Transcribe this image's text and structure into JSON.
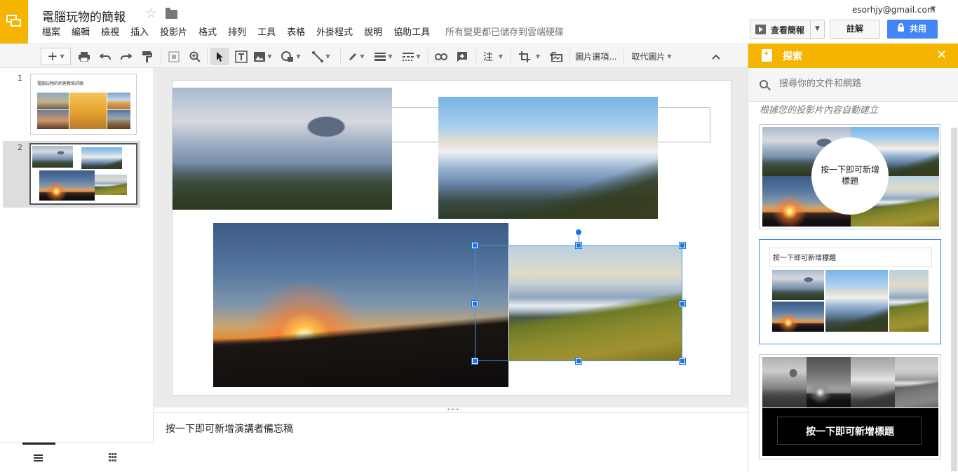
{
  "header": {
    "doc_title": "電腦玩物的簡報",
    "save_status": "所有變更都已儲存到雲端硬碟",
    "account_email": "esorhjy@gmail.com",
    "present_label": "查看簡報",
    "comments_label": "註解",
    "share_label": "共用"
  },
  "menu": [
    "檔案",
    "編輯",
    "檢視",
    "插入",
    "投影片",
    "格式",
    "排列",
    "工具",
    "表格",
    "外掛程式",
    "說明",
    "協助工具"
  ],
  "toolbar": {
    "new_slide_label": "+",
    "number_label": "注",
    "image_options_label": "圖片選項...",
    "replace_image_label": "取代圖片"
  },
  "filmstrip": {
    "slides": [
      {
        "number": "1",
        "title": "電腦玩物的刺客教條評論"
      },
      {
        "number": "2"
      }
    ]
  },
  "notes": {
    "placeholder": "按一下即可新增演講者備忘稿"
  },
  "explore": {
    "title": "探索",
    "search_placeholder": "搜尋你的文件和網路",
    "section_label": "根據您的投影片內容自動建立",
    "cards": [
      {
        "label": "按一下即可新增標題"
      },
      {
        "label": "按一下即可新增標題"
      },
      {
        "label": "按一下即可新增標題"
      }
    ]
  },
  "colors": {
    "brand_yellow": "#f4b400",
    "share_blue": "#4285f4",
    "selection_blue": "#1a73e8"
  },
  "icons": [
    "slides-logo-icon",
    "star-icon",
    "folder-icon",
    "play-icon",
    "lock-icon",
    "print-icon",
    "undo-icon",
    "redo-icon",
    "paint-format-icon",
    "zoom-icon",
    "cursor-icon",
    "textbox-icon",
    "image-icon",
    "shape-icon",
    "line-icon",
    "pen-icon",
    "line-weight-icon",
    "line-dash-icon",
    "link-icon",
    "comment-add-icon",
    "crop-icon",
    "reset-image-icon",
    "collapse-icon",
    "search-icon",
    "close-icon",
    "explore-icon",
    "list-view-icon",
    "grid-view-icon"
  ]
}
